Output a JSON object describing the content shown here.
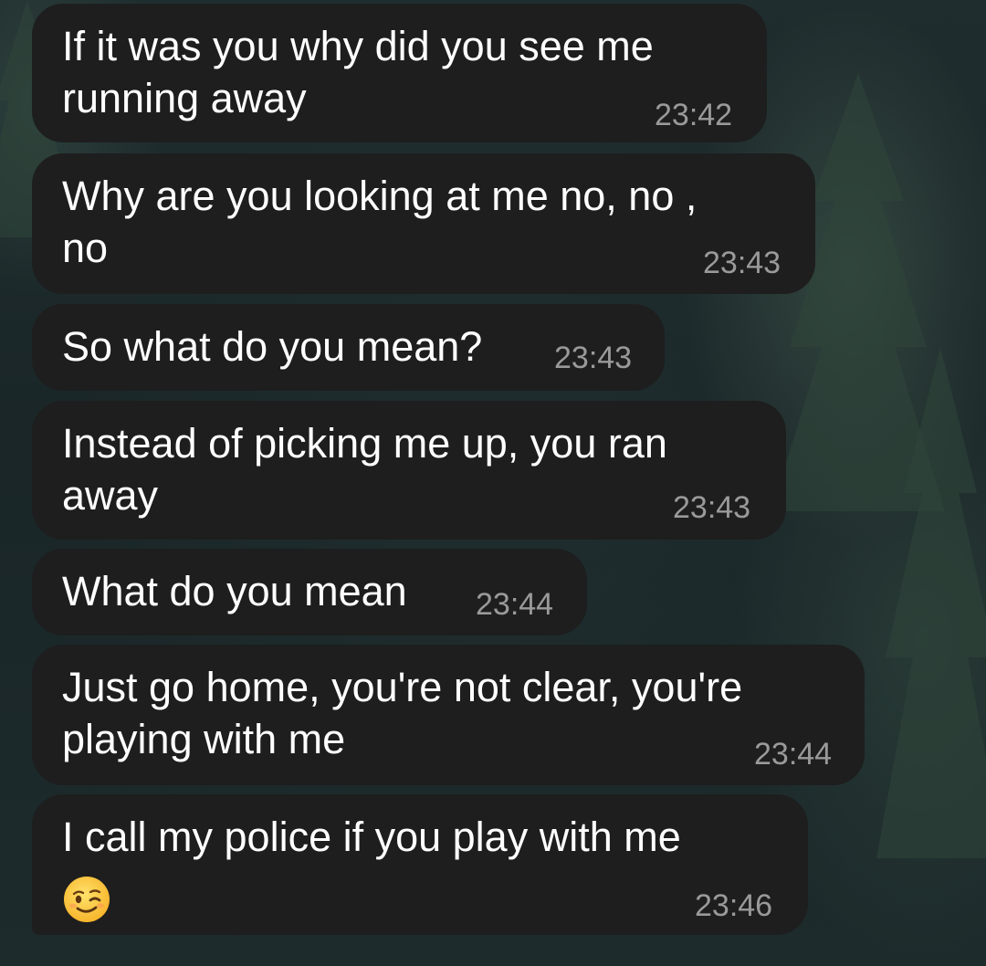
{
  "conversation": {
    "messages": [
      {
        "text": "If it was you why did you see me\nrunning away",
        "time": "23:42"
      },
      {
        "text": "Why are you looking at me no, no ,\nno",
        "time": "23:43"
      },
      {
        "text": "So what do you mean?",
        "time": "23:43"
      },
      {
        "text": "Instead of picking me up, you ran\naway",
        "time": "23:43"
      },
      {
        "text": "What do you mean",
        "time": "23:44"
      },
      {
        "text": "Just go home, you're not clear, you're\nplaying with me",
        "time": "23:44"
      },
      {
        "text": "I call my police if you play with me",
        "time": "23:46",
        "emoji": "winking-face-emoji"
      }
    ]
  },
  "colors": {
    "bubble": "#1e1e1e",
    "text": "#ffffff",
    "timestamp": "#9a9a9a",
    "background": "#1c2a2a"
  }
}
